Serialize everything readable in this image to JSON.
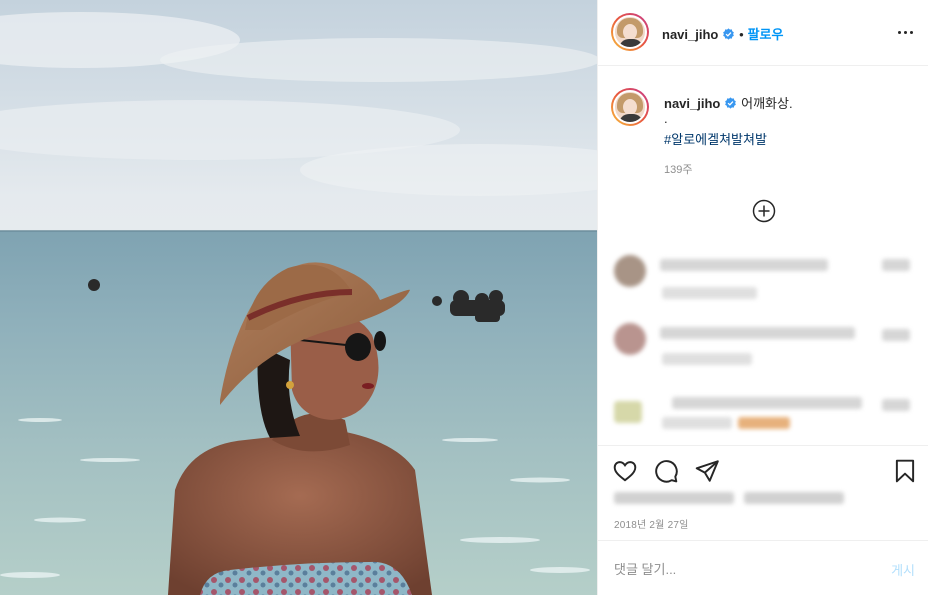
{
  "post": {
    "username": "navi_jiho",
    "follow_separator": "•",
    "follow_label": "팔로우",
    "verified_icon": "verified-badge-icon",
    "more_icon": "more-options-icon"
  },
  "caption": {
    "username": "navi_jiho",
    "text": "어깨화상.",
    "line2": ".",
    "hashtag": "#알로에겔쳐발쳐발",
    "age": "139주"
  },
  "comments": {
    "load_more_icon": "plus-circle-icon",
    "rows_blurred": 3
  },
  "actions": {
    "like_icon": "heart-icon",
    "comment_icon": "comment-icon",
    "share_icon": "share-paper-plane-icon",
    "save_icon": "bookmark-icon",
    "date": "2018년 2월 27일"
  },
  "comment_box": {
    "placeholder": "댓글 달기...",
    "post_label": "게시"
  },
  "colors": {
    "accent": "#0095f6",
    "hashtag": "#00376b",
    "muted": "#8e8e8e",
    "post_disabled": "#b2dffc"
  }
}
